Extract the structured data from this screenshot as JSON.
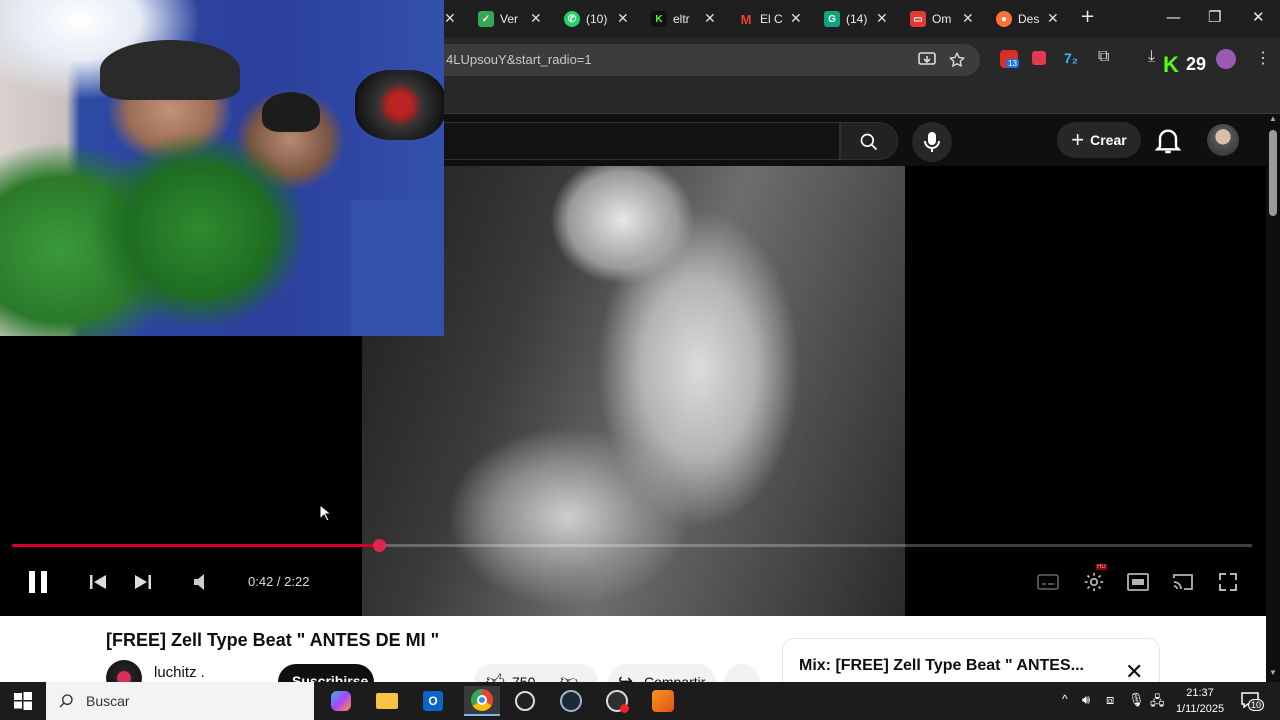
{
  "browser": {
    "tabs": [
      {
        "label": "Ver",
        "favicon": "ver-favicon",
        "color": "#34a853"
      },
      {
        "label": "(10)",
        "favicon": "whatsapp-favicon",
        "color": "#25d366"
      },
      {
        "label": "eltr",
        "favicon": "kick-favicon",
        "color": "#53fc18"
      },
      {
        "label": "El C",
        "favicon": "gmail-favicon",
        "color": "#ea4335"
      },
      {
        "label": "(14)",
        "favicon": "chatgpt-favicon",
        "color": "#10a37f"
      },
      {
        "label": "Om",
        "favicon": "omegle-favicon",
        "color": "#e53935"
      },
      {
        "label": "Des",
        "favicon": "firefox-favicon",
        "color": "#ff7139"
      }
    ],
    "url": "4LUpsouY&start_radio=1",
    "kick_badge": "29",
    "extension_badge": "13"
  },
  "youtube": {
    "create_label": "Crear",
    "video_title": "[FREE] Zell Type Beat \" ANTES DE MI \"",
    "channel_name": "luchitz .",
    "subscribe_label": "Suscribirse",
    "like_count": "750",
    "share_label": "Compartir",
    "mix_title": "Mix: [FREE] Zell Type Beat \" ANTES...",
    "accent": "#ff0033"
  },
  "player": {
    "time_current": "0:42",
    "time_total": "2:22",
    "time_display": "0:42 / 2:22",
    "progress_fraction": 0.296
  },
  "taskbar": {
    "search_placeholder": "Buscar",
    "time": "21:37",
    "date": "1/11/2025",
    "notification_count": "10"
  }
}
